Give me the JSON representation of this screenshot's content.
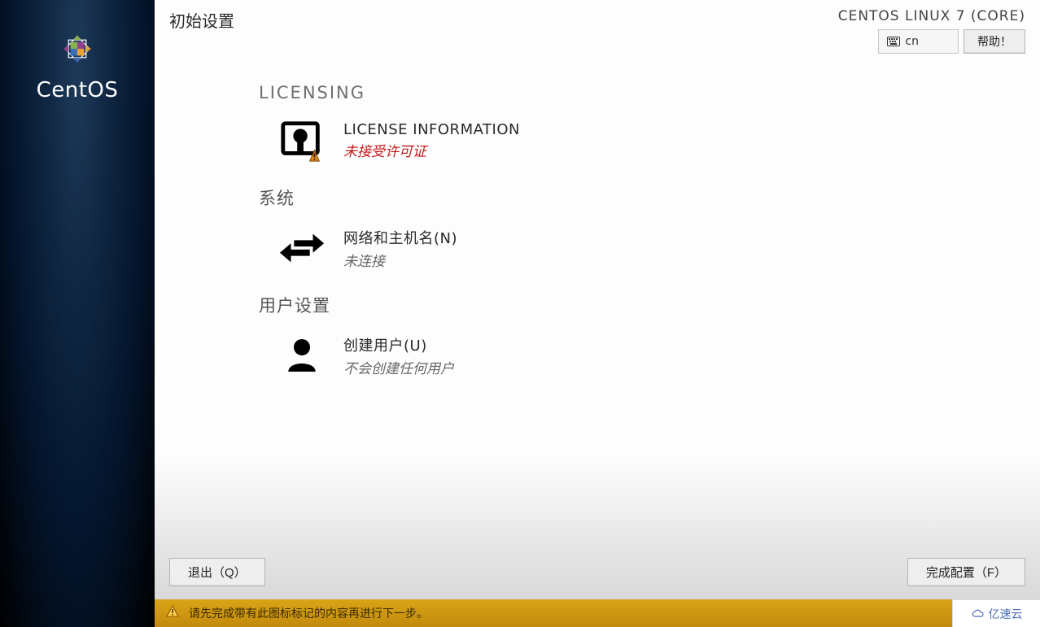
{
  "sidebar": {
    "brand": "CentOS"
  },
  "header": {
    "title": "初始设置",
    "distro": "CENTOS LINUX 7 (CORE)",
    "keyboard_layout": "cn",
    "help_label": "帮助！"
  },
  "sections": {
    "licensing": {
      "heading": "LICENSING",
      "item": {
        "title": "LICENSE INFORMATION",
        "status": "未接受许可证",
        "status_kind": "warning"
      }
    },
    "system": {
      "heading": "系统",
      "item": {
        "title": "网络和主机名(N)",
        "status": "未连接"
      }
    },
    "user": {
      "heading": "用户设置",
      "item": {
        "title": "创建用户(U)",
        "status": "不会创建任何用户"
      }
    }
  },
  "footer": {
    "quit_label": "退出（Q）",
    "finish_label": "完成配置（F）"
  },
  "warning_bar": {
    "message": "请先完成带有此图标标记的内容再进行下一步。"
  },
  "watermark": {
    "text": "亿速云"
  }
}
